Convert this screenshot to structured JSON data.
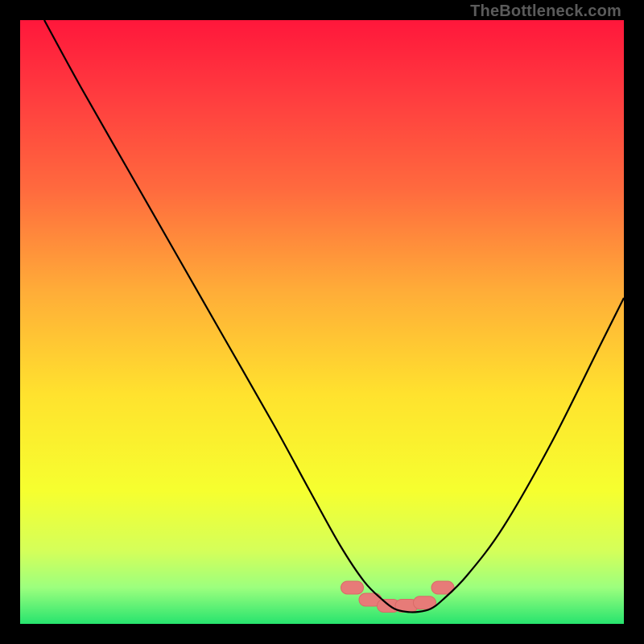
{
  "watermark": "TheBottleneck.com",
  "colors": {
    "gradient_stops": [
      {
        "offset": 0.0,
        "color": "#ff173b"
      },
      {
        "offset": 0.12,
        "color": "#ff3a3f"
      },
      {
        "offset": 0.28,
        "color": "#ff6a3e"
      },
      {
        "offset": 0.45,
        "color": "#ffad38"
      },
      {
        "offset": 0.62,
        "color": "#ffe22e"
      },
      {
        "offset": 0.78,
        "color": "#f6ff2f"
      },
      {
        "offset": 0.88,
        "color": "#d4ff5a"
      },
      {
        "offset": 0.94,
        "color": "#9cff7e"
      },
      {
        "offset": 1.0,
        "color": "#27e46e"
      }
    ],
    "curve": "#000000",
    "marker_fill": "#e77b78",
    "marker_stroke": "#d96a67",
    "background": "#000000"
  },
  "chart_data": {
    "type": "line",
    "title": "",
    "xlabel": "",
    "ylabel": "",
    "xlim": [
      0,
      100
    ],
    "ylim": [
      0,
      100
    ],
    "series": [
      {
        "name": "bottleneck-curve",
        "x": [
          4,
          10,
          18,
          26,
          34,
          42,
          48,
          53,
          57,
          60,
          62,
          64,
          66,
          68,
          70,
          74,
          80,
          88,
          96,
          100
        ],
        "y": [
          100,
          89,
          75,
          61,
          47,
          33,
          22,
          13,
          7,
          4,
          2.5,
          2,
          2,
          2.5,
          4,
          8,
          16,
          30,
          46,
          54
        ]
      }
    ],
    "markers": {
      "name": "highlight-band",
      "x": [
        55,
        58,
        61,
        64,
        67,
        70
      ],
      "y": [
        6,
        4,
        3,
        3,
        3.5,
        6
      ]
    }
  }
}
